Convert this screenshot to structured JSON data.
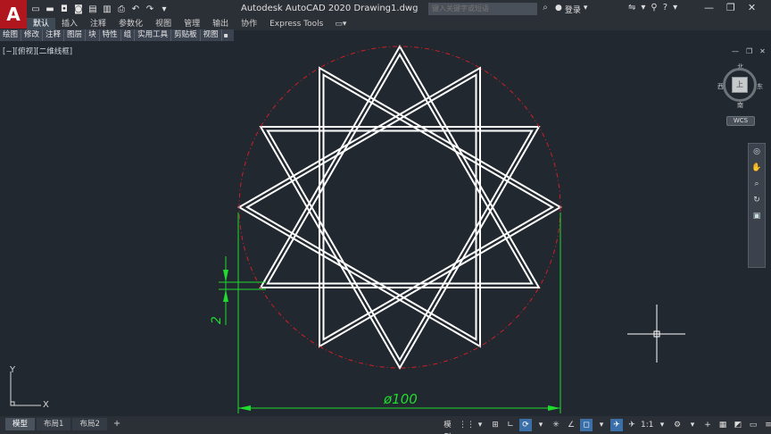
{
  "app": {
    "logo": "A",
    "title": "Autodesk AutoCAD 2020    Drawing1.dwg",
    "search_placeholder": "键入关键字或短语",
    "login": "登录"
  },
  "qat_icons": [
    "new-icon",
    "open-icon",
    "save-icon",
    "save-as-icon",
    "open-web-icon",
    "save-web-icon",
    "plot-icon",
    "undo-icon",
    "redo-icon",
    "customize-icon"
  ],
  "ribbon": {
    "tabs": [
      "默认",
      "插入",
      "注释",
      "参数化",
      "视图",
      "管理",
      "输出",
      "协作",
      "Express Tools"
    ],
    "active_index": 0,
    "extra": "▭▾"
  },
  "panels": [
    "绘图",
    "修改",
    "注释",
    "图层",
    "块",
    "特性",
    "组",
    "实用工具",
    "剪贴板",
    "视图"
  ],
  "viewport": {
    "label": "[−][俯视][二维线框]"
  },
  "viewcube": {
    "north": "北",
    "south": "南",
    "east": "东",
    "west": "西",
    "face": "上",
    "wcs": "WCS"
  },
  "drawing": {
    "diameter_text": "ø100",
    "width_text": "2",
    "colors": {
      "star": "#ffffff",
      "circle": "#d01f26",
      "dimension": "#1fdc2e",
      "crosshair": "#ffffff"
    }
  },
  "ucs": {
    "x": "X",
    "y": "Y"
  },
  "status": {
    "layout_tabs": [
      "模型",
      "布局1",
      "布局2"
    ],
    "active_layout": 0,
    "add": "+",
    "model_btn": "模型",
    "scale": "1:1"
  }
}
